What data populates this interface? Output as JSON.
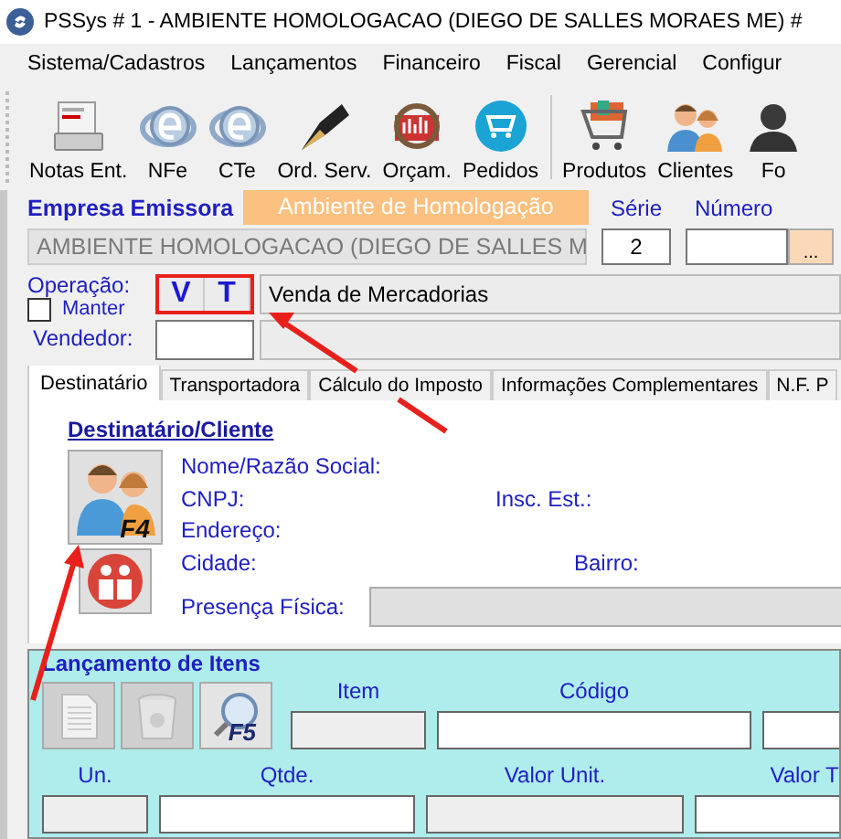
{
  "window": {
    "title": "PSSys # 1 - AMBIENTE HOMOLOGACAO (DIEGO DE SALLES MORAES ME) #"
  },
  "menu": [
    "Sistema/Cadastros",
    "Lançamentos",
    "Financeiro",
    "Fiscal",
    "Gerencial",
    "Configur"
  ],
  "toolbar": [
    {
      "label": "Notas Ent."
    },
    {
      "label": "NFe"
    },
    {
      "label": "CTe"
    },
    {
      "label": "Ord. Serv."
    },
    {
      "label": "Orçam."
    },
    {
      "label": "Pedidos"
    },
    {
      "label": "Produtos"
    },
    {
      "label": "Clientes"
    },
    {
      "label": "Fo"
    }
  ],
  "header": {
    "company_label": "Empresa Emissora",
    "environment_banner": "Ambiente de Homologação",
    "company_combo": "AMBIENTE HOMOLOGACAO  (DIEGO DE SALLES M",
    "serie_label": "Série",
    "serie_value": "2",
    "numero_label": "Número",
    "numero_button": "..."
  },
  "operation": {
    "label": "Operação:",
    "codes": [
      "V",
      "T"
    ],
    "description": "Venda de Mercadorias",
    "manter_label": "Manter",
    "manter_checked": false,
    "vendedor_label": "Vendedor:"
  },
  "tabs": [
    {
      "label": "Destinatário",
      "selected": true
    },
    {
      "label": "Transportadora",
      "selected": false
    },
    {
      "label": "Cálculo do Imposto",
      "selected": false
    },
    {
      "label": "Informações Complementares",
      "selected": false
    },
    {
      "label": "N.F. P",
      "selected": false
    }
  ],
  "customer": {
    "title": "Destinatário/Cliente",
    "button_key": "F4",
    "name_label": "Nome/Razão Social:",
    "cnpj_label": "CNPJ:",
    "ie_label": "Insc. Est.:",
    "address_label": "Endereço:",
    "city_label": "Cidade:",
    "district_label": "Bairro:",
    "presence_label": "Presença Física:"
  },
  "items": {
    "title": "Lançamento de Itens",
    "search_key": "F5",
    "row1": [
      {
        "label": "Item",
        "disabled": true
      },
      {
        "label": "Código",
        "disabled": false
      },
      {
        "disabled": false
      }
    ],
    "row2": [
      {
        "label": "Un.",
        "disabled": true
      },
      {
        "label": "Qtde.",
        "disabled": false
      },
      {
        "label": "Valor Unit.",
        "disabled": true
      },
      {
        "label": "Valor T",
        "disabled": false
      }
    ]
  }
}
